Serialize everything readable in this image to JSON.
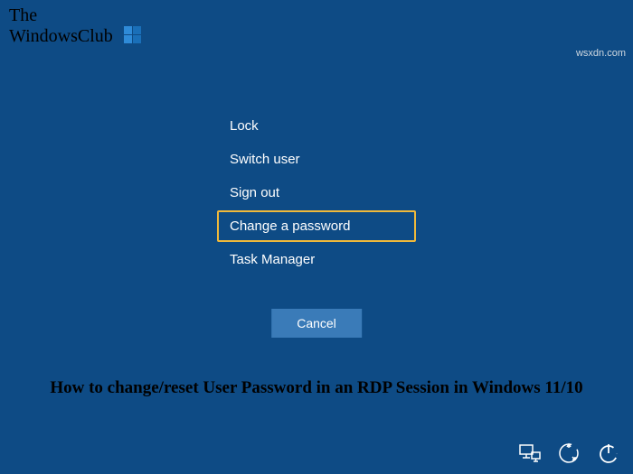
{
  "logo": {
    "line1": "The",
    "line2": "WindowsClub"
  },
  "watermark": "wsxdn.com",
  "menu": {
    "items": [
      {
        "label": "Lock",
        "highlighted": false
      },
      {
        "label": "Switch user",
        "highlighted": false
      },
      {
        "label": "Sign out",
        "highlighted": false
      },
      {
        "label": "Change a password",
        "highlighted": true
      },
      {
        "label": "Task Manager",
        "highlighted": false
      }
    ]
  },
  "cancel_label": "Cancel",
  "caption": "How to change/reset User Password in an RDP Session in Windows 11/10",
  "icons": {
    "network": "network-icon",
    "ease": "ease-of-access-icon",
    "power": "power-icon"
  }
}
